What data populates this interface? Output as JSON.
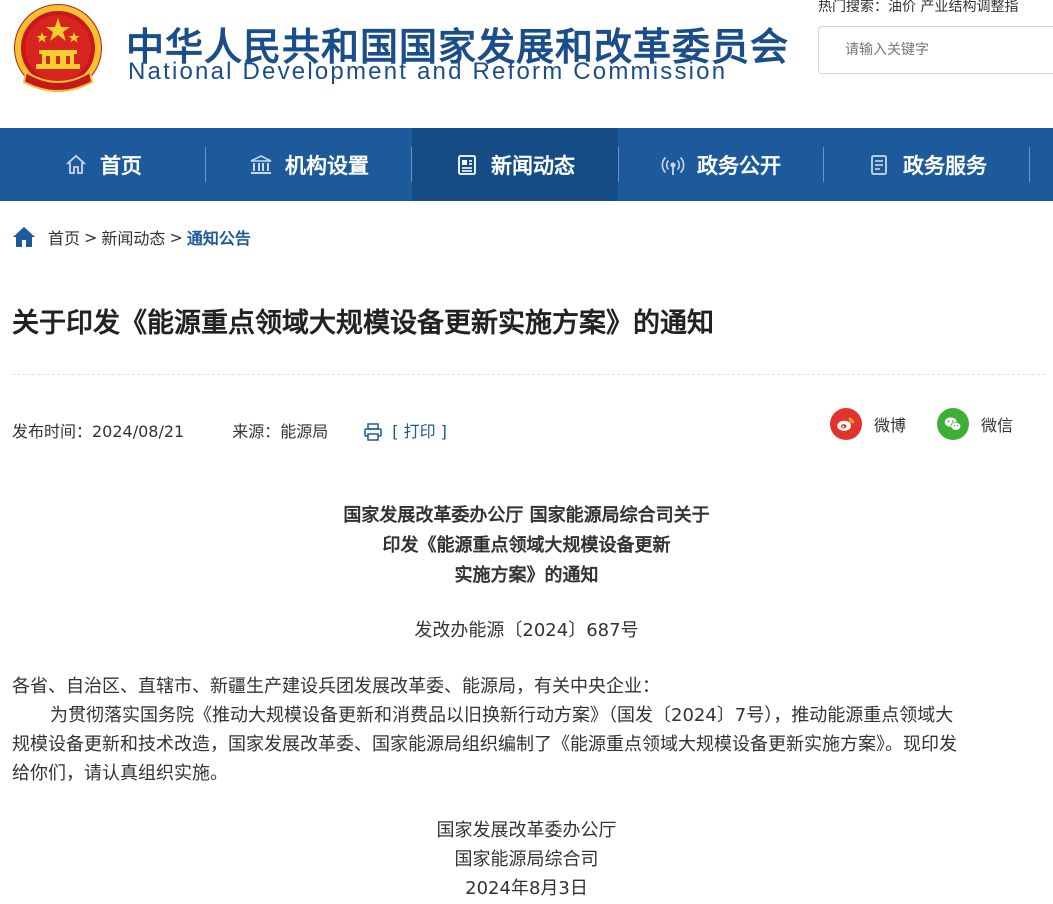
{
  "header": {
    "site_name_cn": "中华人民共和国国家发展和改革委员会",
    "site_name_en": "National Development and Reform Commission",
    "hot_search": "热门搜索：油价 产业结构调整指",
    "search_placeholder": "请输入关键字"
  },
  "nav": {
    "items": [
      {
        "label": "首页",
        "icon": "home-icon"
      },
      {
        "label": "机构设置",
        "icon": "institution-icon"
      },
      {
        "label": "新闻动态",
        "icon": "news-icon",
        "active": true
      },
      {
        "label": "政务公开",
        "icon": "broadcast-icon"
      },
      {
        "label": "政务服务",
        "icon": "document-icon"
      }
    ]
  },
  "breadcrumb": {
    "home": "首页",
    "sep": ">",
    "level2": "新闻动态",
    "current": "通知公告"
  },
  "article": {
    "title": "关于印发《能源重点领域大规模设备更新实施方案》的通知",
    "publish_time": "发布时间：2024/08/21",
    "source": "来源：能源局",
    "print_label": "[ 打印 ]",
    "share_weibo": "微博",
    "share_wechat": "微信",
    "doc_head_lines": [
      "国家发展改革委办公厅 国家能源局综合司关于",
      "印发《能源重点领域大规模设备更新",
      "实施方案》的通知"
    ],
    "doc_number": "发改办能源〔2024〕687号",
    "recipients": "各省、自治区、直辖市、新疆生产建设兵团发展改革委、能源局，有关中央企业：",
    "body_line1": "为贯彻落实国务院《推动大规模设备更新和消费品以旧换新行动方案》（国发〔2024〕7号），推动能源重点领域大",
    "body_line2": "规模设备更新和技术改造，国家发展改革委、国家能源局组织编制了《能源重点领域大规模设备更新实施方案》。现印发",
    "body_line3": "给你们，请认真组织实施。",
    "signatures": [
      "国家发展改革委办公厅",
      "国家能源局综合司",
      "2024年8月3日"
    ]
  },
  "colors": {
    "brand_blue": "#1d5a9b",
    "nav_active": "#164c86",
    "weibo_red": "#e2332c",
    "wechat_green": "#3cb034"
  }
}
